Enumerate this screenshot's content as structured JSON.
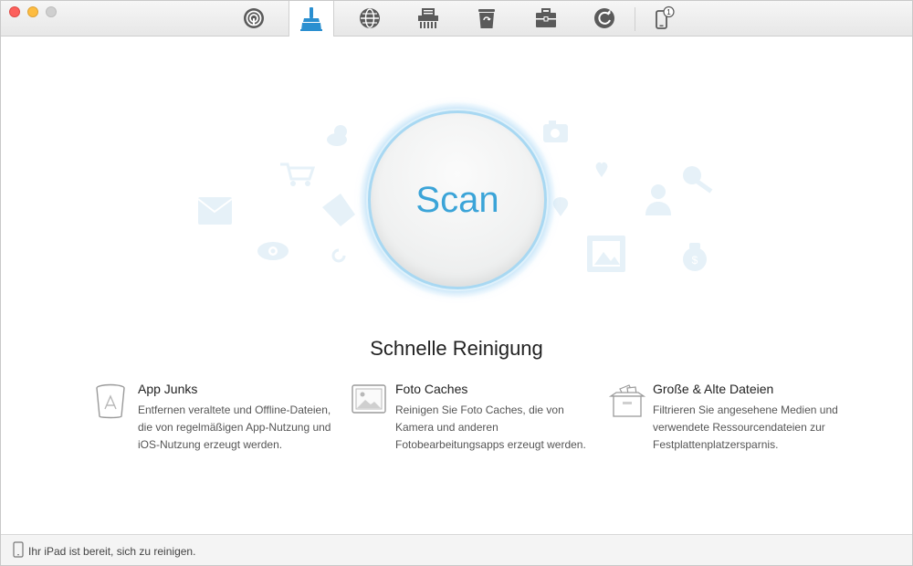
{
  "window": {
    "toolbar": {
      "items": [
        {
          "icon": "airbackup-icon",
          "active": false
        },
        {
          "icon": "cleanup-broom-icon",
          "active": true
        },
        {
          "icon": "internet-junk-icon",
          "active": false
        },
        {
          "icon": "shredder-icon",
          "active": false
        },
        {
          "icon": "trash-icon",
          "active": false
        },
        {
          "icon": "toolbox-icon",
          "active": false
        },
        {
          "icon": "backup-refresh-icon",
          "active": false
        },
        {
          "icon": "device-icon",
          "active": false,
          "badge": "1"
        }
      ]
    }
  },
  "main": {
    "scan_label": "Scan",
    "title": "Schnelle Reinigung",
    "features": [
      {
        "icon": "app-junk-bin-icon",
        "name": "App Junks",
        "description": " Entfernen veraltete und Offline-Dateien, die von regelmäßigen App-Nutzung und iOS-Nutzung erzeugt werden."
      },
      {
        "icon": "photo-cache-icon",
        "name": "Foto Caches",
        "description": "Reinigen Sie Foto Caches, die von Kamera und anderen Fotobearbeitungsapps erzeugt werden."
      },
      {
        "icon": "large-files-box-icon",
        "name": "Große & Alte Dateien",
        "description": "Filtrieren Sie angesehene Medien und verwendete Ressourcendateien zur Festplattenplatzersparnis."
      }
    ]
  },
  "status": {
    "text": "Ihr iPad ist bereit, sich zu reinigen."
  },
  "colors": {
    "accent": "#3ba4d8",
    "active_tab_icon": "#2a8fd0",
    "toolbar_icon": "#555555",
    "deco_icon": "#e6f1f8"
  }
}
